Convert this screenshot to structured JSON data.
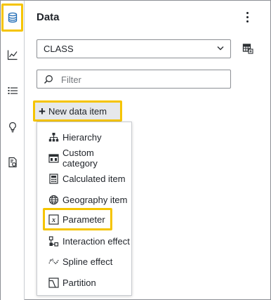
{
  "panel": {
    "title": "Data"
  },
  "rail": {
    "items": [
      {
        "icon": "database-icon",
        "active": true
      },
      {
        "icon": "line-chart-icon",
        "active": false
      },
      {
        "icon": "list-icon",
        "active": false
      },
      {
        "icon": "lightbulb-icon",
        "active": false
      },
      {
        "icon": "document-settings-icon",
        "active": false
      }
    ]
  },
  "data_source": {
    "selected": "CLASS"
  },
  "filter": {
    "placeholder": "Filter",
    "value": ""
  },
  "new_data_item": {
    "label": "New data item"
  },
  "menu": {
    "items": [
      {
        "label": "Hierarchy",
        "icon": "hierarchy-icon"
      },
      {
        "label": "Custom category",
        "icon": "custom-category-icon"
      },
      {
        "label": "Calculated item",
        "icon": "calculator-icon"
      },
      {
        "label": "Geography item",
        "icon": "globe-icon"
      },
      {
        "label": "Parameter",
        "icon": "parameter-icon"
      },
      {
        "label": "Interaction effect",
        "icon": "interaction-effect-icon"
      },
      {
        "label": "Spline effect",
        "icon": "spline-effect-icon"
      },
      {
        "label": "Partition",
        "icon": "partition-icon"
      }
    ]
  },
  "colors": {
    "highlight": "#f5c400",
    "accent": "#1f6bb5"
  }
}
